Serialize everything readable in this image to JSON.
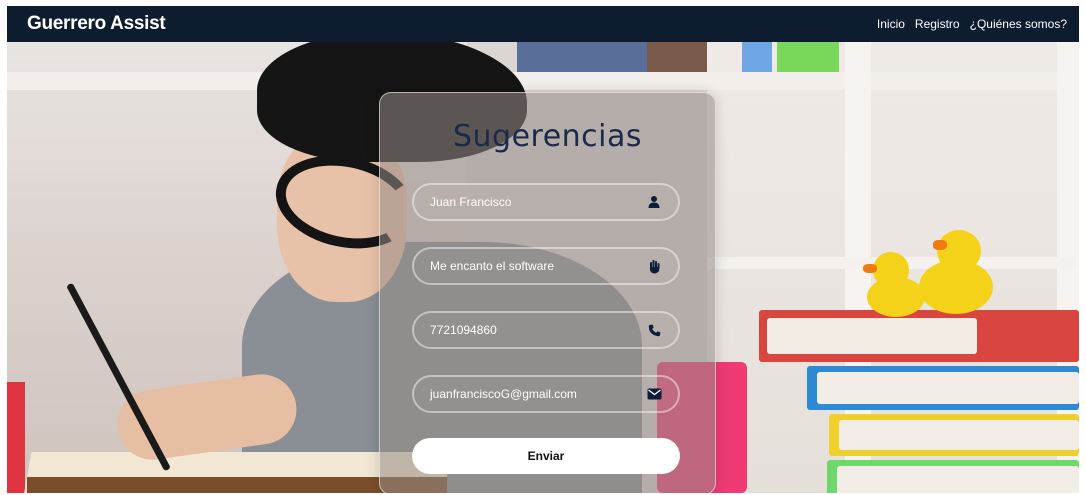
{
  "app": {
    "brand": "Guerrero Assist"
  },
  "nav": {
    "items": [
      {
        "label": "Inicio"
      },
      {
        "label": "Registro"
      },
      {
        "label": "¿Quiénes somos?"
      }
    ]
  },
  "form": {
    "title": "Sugerencias",
    "fields": [
      {
        "value": "Juan Francisco",
        "icon": "user-icon"
      },
      {
        "value": "Me encanto el software",
        "icon": "hand-icon"
      },
      {
        "value": "7721094860",
        "icon": "phone-icon"
      },
      {
        "value": "juanfranciscoG@gmail.com",
        "icon": "envelope-icon"
      }
    ],
    "submit_label": "Enviar"
  },
  "colors": {
    "navbar": "#0d1c2e",
    "title": "#1c2a4a",
    "icon": "#0d1c3a",
    "button": "#ffffff"
  }
}
